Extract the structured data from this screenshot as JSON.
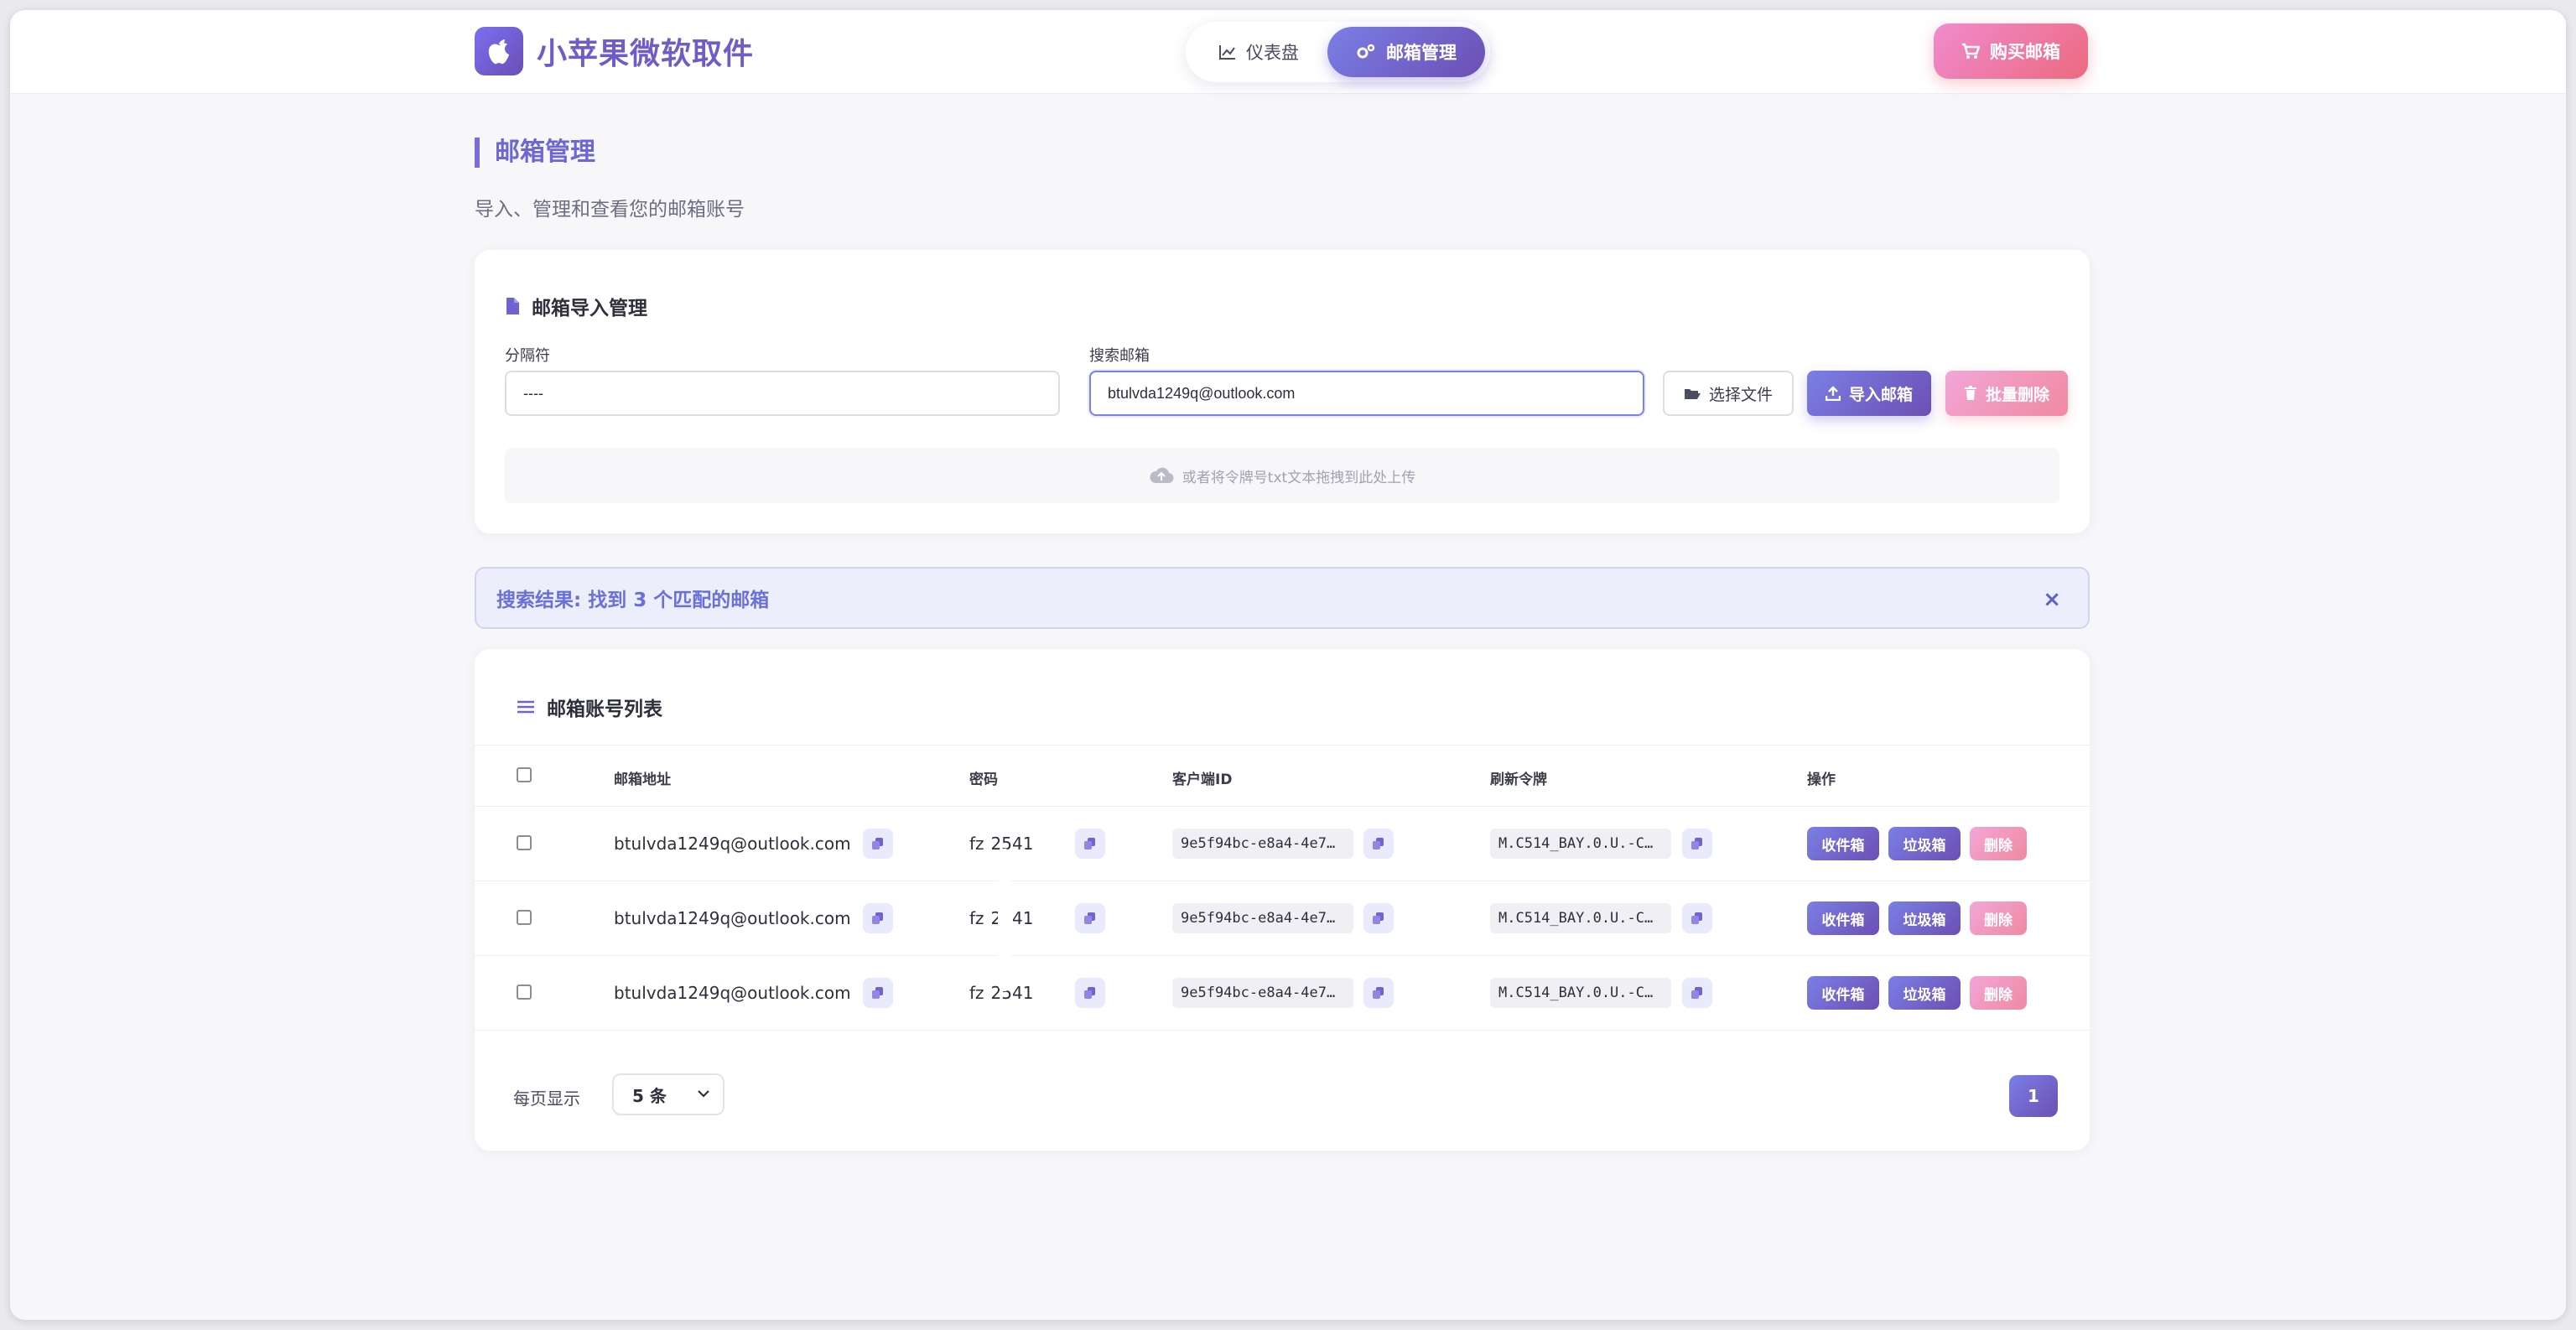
{
  "app": {
    "name": "小苹果微软取件"
  },
  "nav": {
    "items": [
      {
        "label": "仪表盘",
        "icon": "chart-line-icon",
        "active": false
      },
      {
        "label": "邮箱管理",
        "icon": "gears-icon",
        "active": true
      }
    ],
    "buy_label": "购买邮箱"
  },
  "page": {
    "title": "邮箱管理",
    "subtitle": "导入、管理和查看您的邮箱账号"
  },
  "import": {
    "title": "邮箱导入管理",
    "separator_label": "分隔符",
    "separator_value": "----",
    "search_label": "搜索邮箱",
    "search_value": "btulvda1249q@outlook.com",
    "choose_file": "选择文件",
    "import_btn": "导入邮箱",
    "batch_delete": "批量删除",
    "drop_hint": "或者将令牌号txt文本拖拽到此处上传"
  },
  "search_result": {
    "text": "搜索结果: 找到 3 个匹配的邮箱",
    "close": "×"
  },
  "list": {
    "title": "邮箱账号列表",
    "columns": [
      "邮箱地址",
      "密码",
      "客户端ID",
      "刷新令牌",
      "操作"
    ],
    "rows": [
      {
        "email": "btulvda1249q@outlook.com",
        "password": "fz  2541",
        "client_id": "9e5f94bc-e8a4-4e7…",
        "token": "M.C514_BAY.0.U.-C…"
      },
      {
        "email": "btulvda1249q@outlook.com",
        "password": "fz  2541",
        "client_id": "9e5f94bc-e8a4-4e7…",
        "token": "M.C514_BAY.0.U.-C…"
      },
      {
        "email": "btulvda1249q@outlook.com",
        "password": "fz  2541",
        "client_id": "9e5f94bc-e8a4-4e7…",
        "token": "M.C514_BAY.0.U.-C…"
      }
    ],
    "actions": {
      "inbox": "收件箱",
      "junk": "垃圾箱",
      "delete": "删除"
    },
    "per_page_label": "每页显示",
    "per_page_value": "5 条",
    "current_page": "1"
  },
  "colors": {
    "accent": "#6c4fb3",
    "accent_light": "#7a7fe6",
    "pink": "#ec6a7e"
  }
}
